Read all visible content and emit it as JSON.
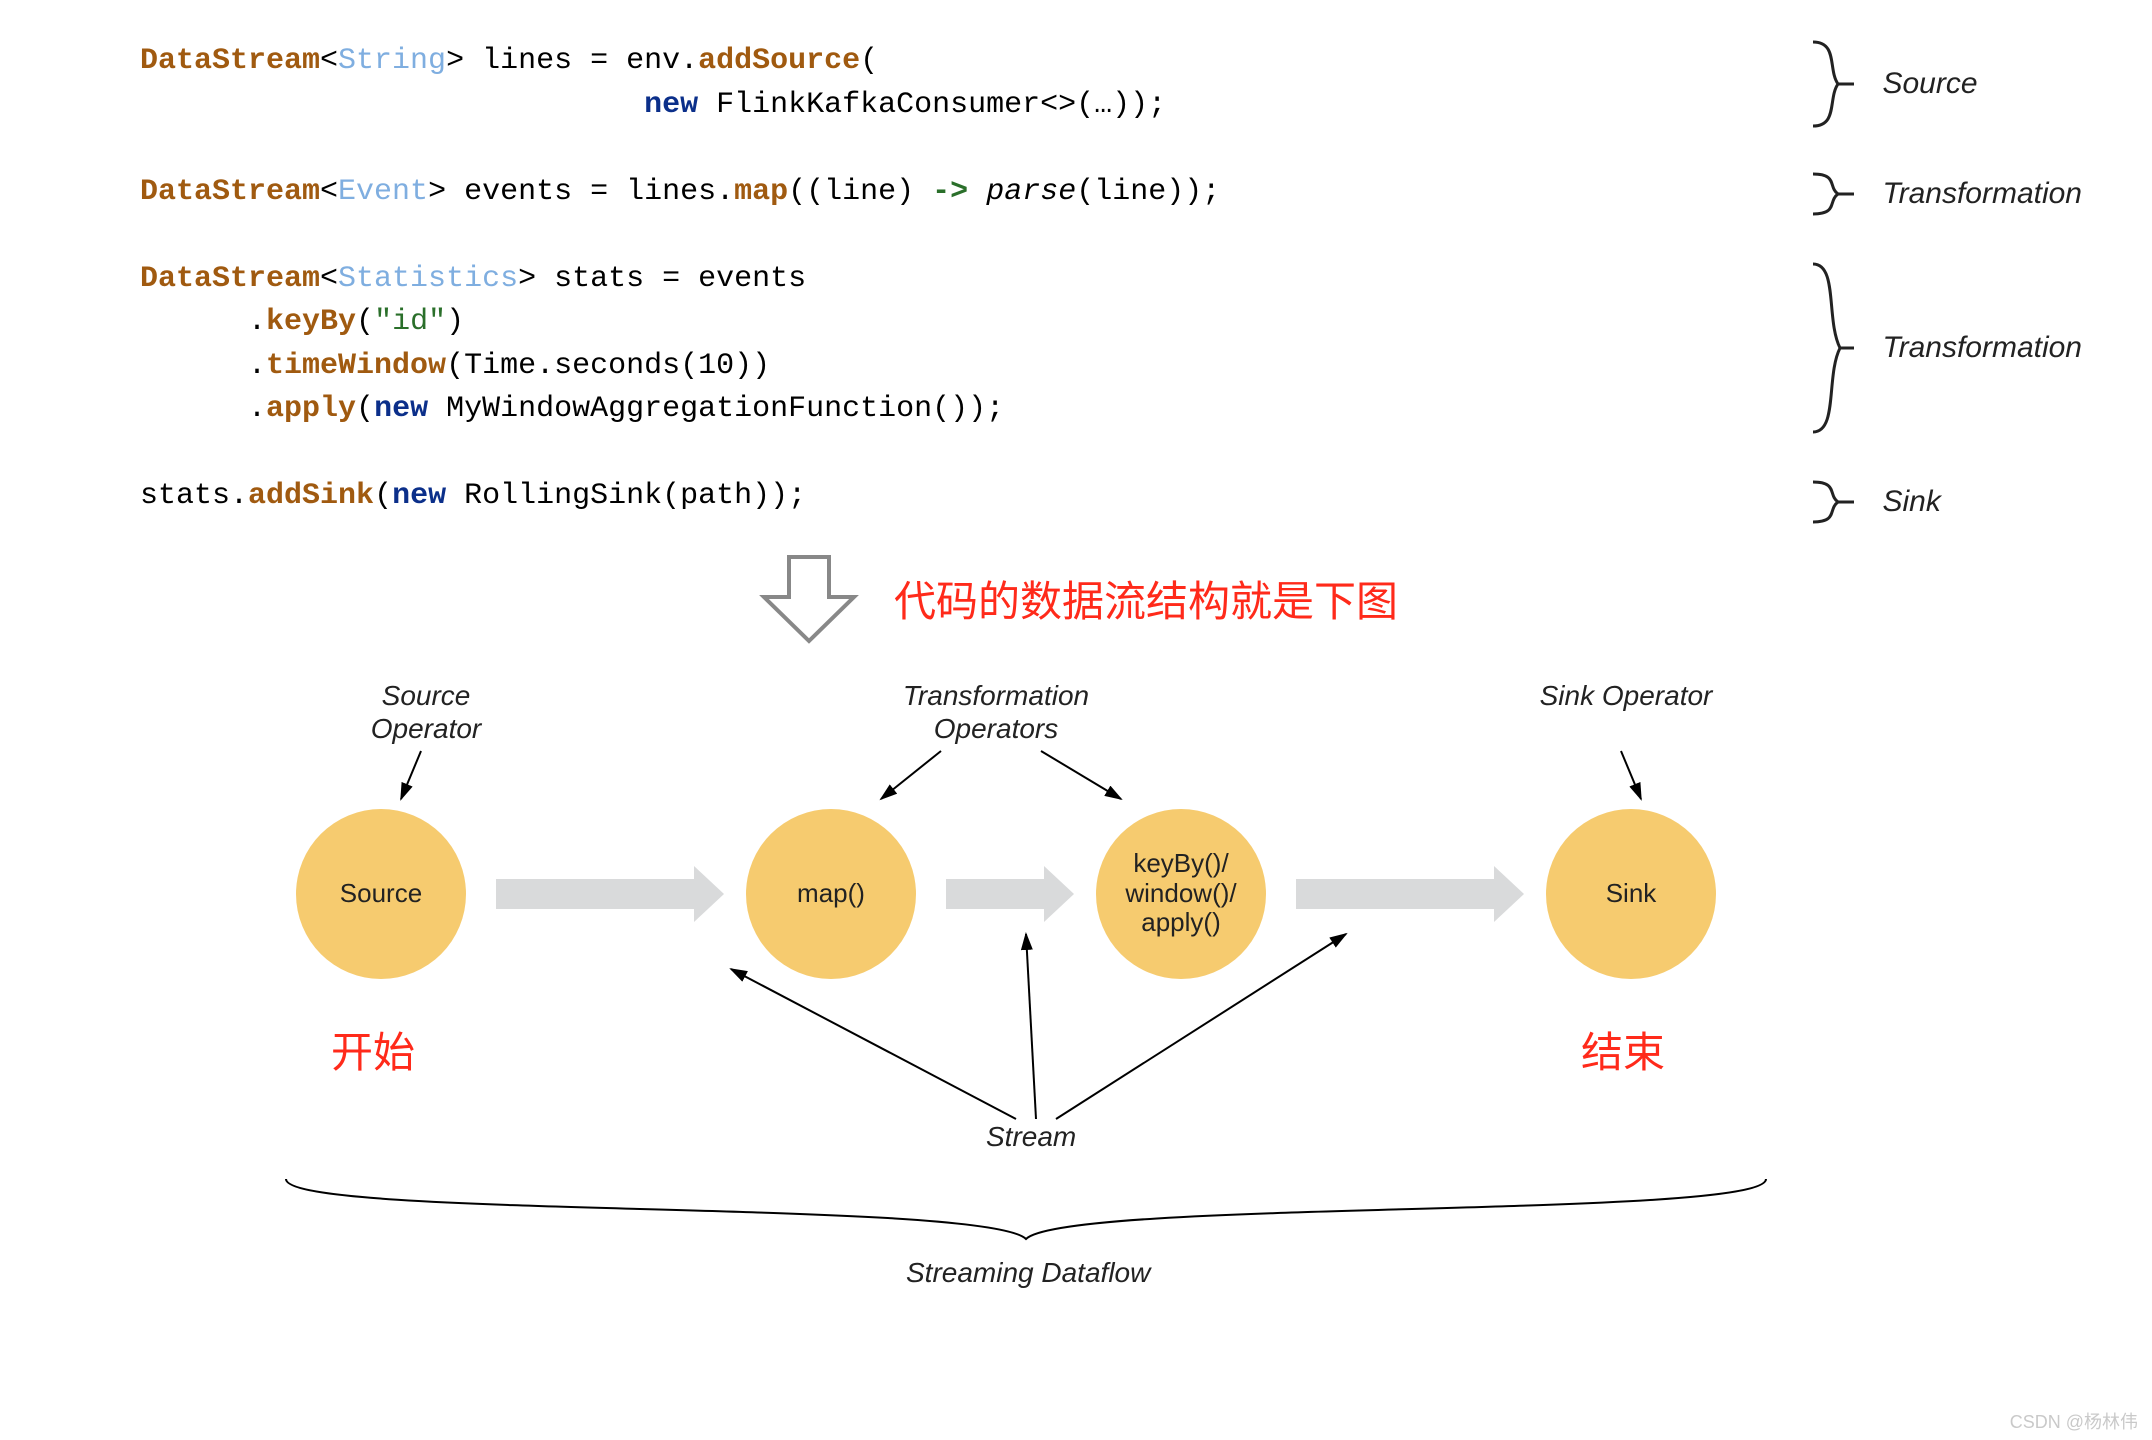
{
  "code": {
    "block1": {
      "ds": "DataStream",
      "typ": "String",
      "var": " lines = env.",
      "method": "addSource",
      "tail1": "(",
      "new": "new",
      "tail2": " FlinkKafkaConsumer<>(…));",
      "label": "Source"
    },
    "block2": {
      "ds": "DataStream",
      "typ": "Event",
      "var": " events = lines.",
      "method": "map",
      "mid": "((line) ",
      "arrow": "->",
      "call": " parse",
      "tail": "(line));",
      "label": "Transformation"
    },
    "block3": {
      "ds": "DataStream",
      "typ": "Statistics",
      "var": " stats = events",
      "m1": "keyBy",
      "s1": "\"id\"",
      "m2": "timeWindow",
      "a2": "(Time.seconds(10))",
      "m3": "apply",
      "new": "new",
      "a3": " MyWindowAggregationFunction());",
      "label": "Transformation"
    },
    "block4": {
      "pre": "stats.",
      "method": "addSink",
      "open": "(",
      "new": "new",
      "tail": " RollingSink(path));",
      "label": "Sink"
    }
  },
  "annot": {
    "center": "代码的数据流结构就是下图",
    "start": "开始",
    "end": "结束"
  },
  "diagram": {
    "nodes": {
      "source": "Source",
      "map": "map()",
      "keyby": "keyBy()/\nwindow()/\napply()",
      "sink": "Sink"
    },
    "ops": {
      "source": "Source\nOperator",
      "trans": "Transformation\nOperators",
      "sink": "Sink\nOperator"
    },
    "stream": "Stream",
    "dataflow": "Streaming Dataflow"
  },
  "watermark": "CSDN @杨林伟"
}
